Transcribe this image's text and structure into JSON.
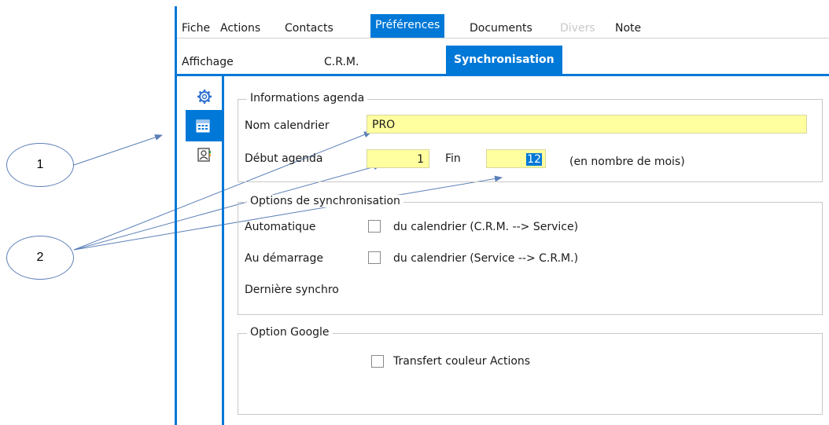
{
  "tabs": {
    "fiche": "Fiche",
    "actions": "Actions",
    "contacts": "Contacts",
    "preferences": "Préférences",
    "documents": "Documents",
    "divers": "Divers",
    "note": "Note"
  },
  "subtabs": {
    "affichage": "Affichage",
    "crm": "C.R.M.",
    "synchronisation": "Synchronisation"
  },
  "sidebar": {
    "icons": [
      "gear-icon",
      "calendar-icon",
      "contact-card-icon"
    ],
    "active_index": 1
  },
  "agenda": {
    "legend": "Informations  agenda",
    "calendar_name_label": "Nom calendrier",
    "calendar_name_value": "PRO",
    "start_label": "Début agenda",
    "start_value": "1",
    "end_label": "Fin",
    "end_value": "12",
    "unit_note": "(en nombre de mois)"
  },
  "sync_options": {
    "legend": "Options de synchronisation",
    "auto_label": "Automatique",
    "auto_option": "du calendrier (C.R.M. --> Service)",
    "startup_label": "Au démarrage",
    "startup_option": "du calendrier (Service --> C.R.M.)",
    "last_sync_label": "Dernière synchro"
  },
  "google": {
    "legend": "Option Google",
    "transfer_colors": "Transfert couleur Actions"
  },
  "callouts": {
    "one": "1",
    "two": "2"
  },
  "colors": {
    "accent": "#0078d7",
    "field_bg": "#ffffa0",
    "callout_border": "#5b7fb8"
  }
}
